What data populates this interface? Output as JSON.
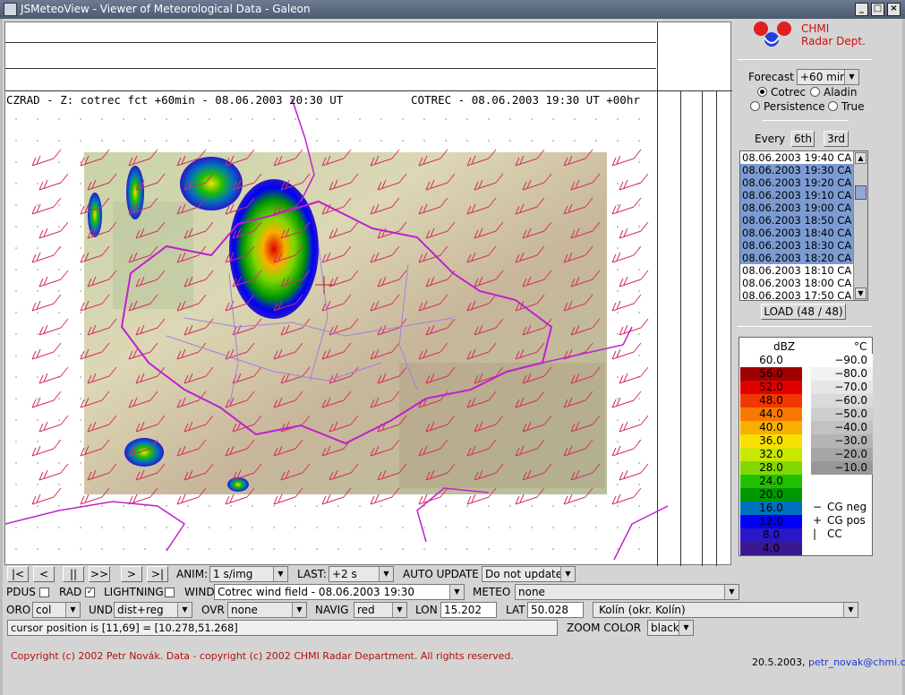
{
  "window": {
    "title": "JSMeteoView - Viewer of Meteorological Data - Galeon"
  },
  "map": {
    "label_left": "CZRAD - Z: cotrec fct +60min - 08.06.2003 20:30 UT",
    "label_right": "COTREC - 08.06.2003 19:30 UT +00hr"
  },
  "logo": {
    "line1": "CHMI",
    "line2": "Radar Dept."
  },
  "forecast": {
    "label": "Forecast",
    "value": "+60 min",
    "options": [
      {
        "name": "cotrec",
        "label": "Cotrec",
        "checked": true
      },
      {
        "name": "aladin",
        "label": "Aladin",
        "checked": false
      },
      {
        "name": "persistence",
        "label": "Persistence",
        "checked": false
      },
      {
        "name": "true",
        "label": "True",
        "checked": false
      }
    ]
  },
  "every": {
    "label": "Every",
    "btn1": "6th",
    "btn2": "3rd"
  },
  "times": [
    {
      "t": "08.06.2003 19:40 CA",
      "sel": false
    },
    {
      "t": "08.06.2003 19:30 CA",
      "sel": true
    },
    {
      "t": "08.06.2003 19:20 CA",
      "sel": true
    },
    {
      "t": "08.06.2003 19:10 CA",
      "sel": true
    },
    {
      "t": "08.06.2003 19:00 CA",
      "sel": true
    },
    {
      "t": "08.06.2003 18:50 CA",
      "sel": true
    },
    {
      "t": "08.06.2003 18:40 CA",
      "sel": true
    },
    {
      "t": "08.06.2003 18:30 CA",
      "sel": true
    },
    {
      "t": "08.06.2003 18:20 CA",
      "sel": true
    },
    {
      "t": "08.06.2003 18:10 CA",
      "sel": false
    },
    {
      "t": "08.06.2003 18:00 CA",
      "sel": false
    },
    {
      "t": "08.06.2003 17:50 CA",
      "sel": false
    }
  ],
  "load": {
    "label": "LOAD (48 / 48)"
  },
  "legend": {
    "dbz_title": "dBZ",
    "temp_title": "°C",
    "dbz": [
      {
        "v": "60.0",
        "c": "#ffffff",
        "t": "#000"
      },
      {
        "v": "56.0",
        "c": "#a00000",
        "t": "#000"
      },
      {
        "v": "52.0",
        "c": "#e00000",
        "t": "#000"
      },
      {
        "v": "48.0",
        "c": "#f03800",
        "t": "#000"
      },
      {
        "v": "44.0",
        "c": "#f87800",
        "t": "#000"
      },
      {
        "v": "40.0",
        "c": "#f8b000",
        "t": "#000"
      },
      {
        "v": "36.0",
        "c": "#f8e000",
        "t": "#000"
      },
      {
        "v": "32.0",
        "c": "#c8e800",
        "t": "#000"
      },
      {
        "v": "28.0",
        "c": "#80d800",
        "t": "#000"
      },
      {
        "v": "24.0",
        "c": "#20c000",
        "t": "#000"
      },
      {
        "v": "20.0",
        "c": "#009800",
        "t": "#000"
      },
      {
        "v": "16.0",
        "c": "#0070c0",
        "t": "#000"
      },
      {
        "v": "12.0",
        "c": "#0000f8",
        "t": "#000"
      },
      {
        "v": "8.0",
        "c": "#2818c8",
        "t": "#000"
      },
      {
        "v": "4.0",
        "c": "#3a1890",
        "t": "#000"
      }
    ],
    "temp": [
      {
        "v": "−90.0",
        "c": "#ffffff"
      },
      {
        "v": "−80.0",
        "c": "#f2f2f2"
      },
      {
        "v": "−70.0",
        "c": "#e6e6e6"
      },
      {
        "v": "−60.0",
        "c": "#dadada"
      },
      {
        "v": "−50.0",
        "c": "#cecece"
      },
      {
        "v": "−40.0",
        "c": "#c2c2c2"
      },
      {
        "v": "−30.0",
        "c": "#b4b4b4"
      },
      {
        "v": "−20.0",
        "c": "#a6a6a6"
      },
      {
        "v": "−10.0",
        "c": "#989898"
      }
    ],
    "lightning": [
      {
        "sym": "−",
        "label": "CG neg"
      },
      {
        "sym": "+",
        "label": "CG pos"
      },
      {
        "sym": "|",
        "label": "CC"
      }
    ]
  },
  "controls": {
    "nav": [
      "|<",
      "<",
      "||",
      ">>",
      ">",
      ">|"
    ],
    "anim_label": "ANIM:",
    "anim_value": "1 s/img",
    "last_label": "LAST:",
    "last_value": "+2 s",
    "auto_label": "AUTO UPDATE",
    "auto_value": "Do not update",
    "pdus_label": "PDUS",
    "rad_label": "RAD",
    "lightning_label": "LIGHTNING",
    "wind_label": "WIND",
    "wind_value": "Cotrec wind field - 08.06.2003 19:30",
    "meteo_label": "METEO",
    "meteo_value": "none",
    "oro_label": "ORO",
    "oro_value": "col",
    "und_label": "UND",
    "und_value": "dist+reg",
    "ovr_label": "OVR",
    "ovr_value": "none",
    "navig_label": "NAVIG",
    "navig_value": "red",
    "lon_label": "LON",
    "lon_value": "15.202",
    "lat_label": "LAT",
    "lat_value": "50.028",
    "place_value": "Kolín (okr. Kolín)",
    "cursor_text": "cursor position is [11,69] = [10.278,51.268]",
    "zoom_label": "ZOOM COLOR",
    "zoom_value": "black"
  },
  "footer": {
    "copyright": "Copyright (c) 2002 Petr Novák. Data - copyright (c) 2002 CHMI Radar Department. All rights reserved.",
    "date": "20.5.2003,",
    "email": "petr_novak@chmi.cz"
  }
}
